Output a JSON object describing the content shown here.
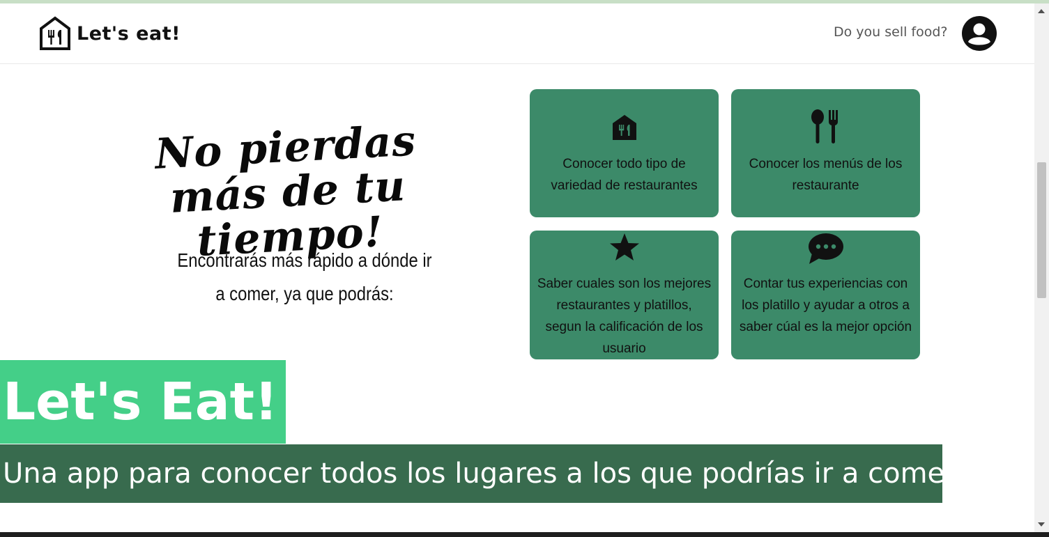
{
  "header": {
    "brand": "Let's eat!",
    "sell_link": "Do you sell food?"
  },
  "hero": {
    "title": "No pierdas más de tu tiempo!",
    "subtitle": "Encontrarás más rápido a dónde ir a comer, ya que podrás:"
  },
  "features": [
    {
      "icon": "restaurant-house-icon",
      "text": "Conocer todo tipo de variedad de restaurantes"
    },
    {
      "icon": "spoon-fork-icon",
      "text": "Conocer los menús de los restaurante"
    },
    {
      "icon": "star-icon",
      "text": "Saber cuales son los mejores restaurantes y platillos, segun la calificación de los usuario"
    },
    {
      "icon": "chat-bubble-icon",
      "text": "Contar tus experiencias con los platillo y ayudar a otros a saber cúal es la mejor opción"
    }
  ],
  "banner": {
    "title": "Let's Eat!",
    "subtitle": "Una app para conocer todos los lugares a los que podrías ir a comer"
  },
  "colors": {
    "card_bg": "#3c8a69",
    "banner_light": "#44cf88",
    "banner_dark": "#386b4e"
  }
}
